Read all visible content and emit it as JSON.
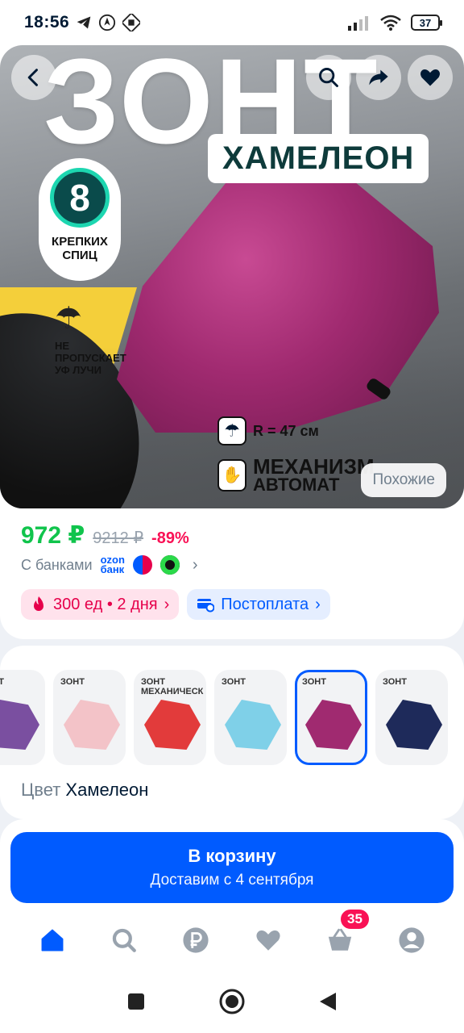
{
  "status_bar": {
    "time": "18:56",
    "battery": "37"
  },
  "product": {
    "image": {
      "title_text": "ЗОНТ",
      "subtitle_text": "ХАМЕЛЕОН",
      "spokes_number": "8",
      "spokes_text": "КРЕПКИХ СПИЦ",
      "uv_text": "НЕ ПРОПУСКАЕТ УФ ЛУЧИ",
      "radius_text": "R = 47 см",
      "mechanism_line1": "МЕХАНИЗМ",
      "mechanism_line2": "АВТОМАТ"
    },
    "similar_label": "Похожие",
    "price_current": "972 ₽",
    "price_old": "9212 ₽",
    "discount": "-89%",
    "banks_label": "С банками",
    "ozon_bank_line1": "ozon",
    "ozon_bank_line2": "банк",
    "promo_chip": "300 ед • 2 дня",
    "postpay_chip": "Постоплата"
  },
  "variants": {
    "thumbs": [
      {
        "label": "ЗОНТ",
        "color": "#7a4fa0"
      },
      {
        "label": "ЗОНТ",
        "color": "#f3c3c8"
      },
      {
        "label": "ЗОНТ МЕХАНИЧЕСКИЙ",
        "color": "#e23b3b"
      },
      {
        "label": "ЗОНТ",
        "color": "#7fd0e8"
      },
      {
        "label": "ЗОНТ",
        "color": "#a02a70"
      },
      {
        "label": "ЗОНТ",
        "color": "#1e2a5a"
      }
    ],
    "selected_index": 4,
    "color_label": "Цвет",
    "color_value": "Хамелеон"
  },
  "cart": {
    "button_title": "В корзину",
    "button_subtitle": "Доставим с 4 сентября"
  },
  "bottom_nav": {
    "items": [
      "home-icon",
      "search-icon",
      "ruble-icon",
      "heart-icon",
      "cart-icon",
      "profile-icon"
    ],
    "cart_badge": "35",
    "accent": "#005bff",
    "inactive": "#99a3ae"
  }
}
